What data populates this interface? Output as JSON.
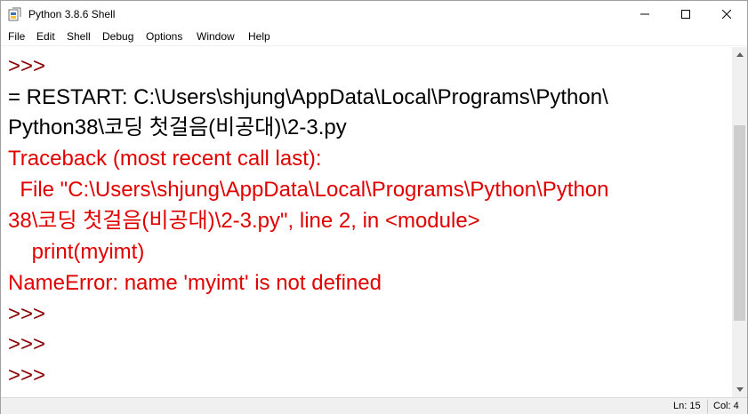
{
  "window": {
    "title": "Python 3.8.6 Shell"
  },
  "menu": {
    "items": [
      "File",
      "Edit",
      "Shell",
      "Debug",
      "Options",
      "Window",
      "Help"
    ]
  },
  "shell": {
    "lines": [
      {
        "text": ">>>",
        "kind": "prompt"
      },
      {
        "text": "= RESTART: C:\\Users\\shjung\\AppData\\Local\\Programs\\Python\\",
        "kind": "stdout"
      },
      {
        "text": "Python38\\코딩 첫걸음(비공대)\\2-3.py",
        "kind": "stdout"
      },
      {
        "text": "Traceback (most recent call last):",
        "kind": "error"
      },
      {
        "text": "  File \"C:\\Users\\shjung\\AppData\\Local\\Programs\\Python\\Python",
        "kind": "error"
      },
      {
        "text": "38\\코딩 첫걸음(비공대)\\2-3.py\", line 2, in <module>",
        "kind": "error"
      },
      {
        "text": "    print(myimt)",
        "kind": "error"
      },
      {
        "text": "NameError: name 'myimt' is not defined",
        "kind": "error"
      },
      {
        "text": ">>>",
        "kind": "prompt"
      },
      {
        "text": ">>>",
        "kind": "prompt"
      },
      {
        "text": ">>>",
        "kind": "prompt"
      }
    ]
  },
  "status": {
    "line": "Ln: 15",
    "col": "Col: 4"
  },
  "colors": {
    "prompt": "#8b0000",
    "error": "#e00000",
    "stdout": "#000000"
  }
}
